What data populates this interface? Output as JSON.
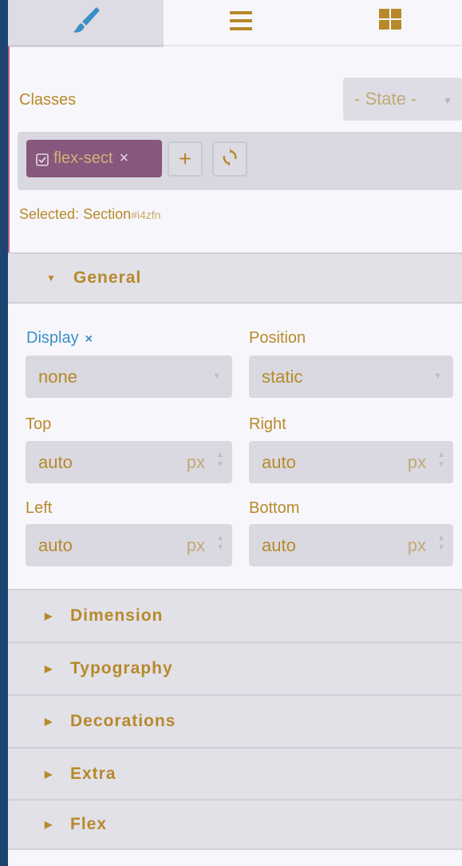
{
  "tabs": {
    "style_icon": "paint-brush-icon",
    "layers_icon": "hamburger-menu-icon",
    "blocks_icon": "grid-blocks-icon"
  },
  "classes": {
    "label": "Classes",
    "state_placeholder": "- State -",
    "tag_label": "flex-sect",
    "tag_close": "×",
    "add_label": "+",
    "selected_label": "Selected:",
    "selected_component": "Section",
    "selected_id": "#i4zfn"
  },
  "general": {
    "title": "General",
    "display_label": "Display",
    "display_clear": "×",
    "display_value": "none",
    "position_label": "Position",
    "position_value": "static",
    "top_label": "Top",
    "top_value": "auto",
    "top_unit": "px",
    "right_label": "Right",
    "right_value": "auto",
    "right_unit": "px",
    "left_label": "Left",
    "left_value": "auto",
    "left_unit": "px",
    "bottom_label": "Bottom",
    "bottom_value": "auto",
    "bottom_unit": "px"
  },
  "sectors": {
    "dimension": "Dimension",
    "typography": "Typography",
    "decorations": "Decorations",
    "extra": "Extra",
    "flex": "Flex"
  },
  "colors": {
    "accent_gold": "#b7892a",
    "tag_purple": "#87577d",
    "display_blue": "#3a8fc6",
    "app_background": "#1b4470"
  }
}
